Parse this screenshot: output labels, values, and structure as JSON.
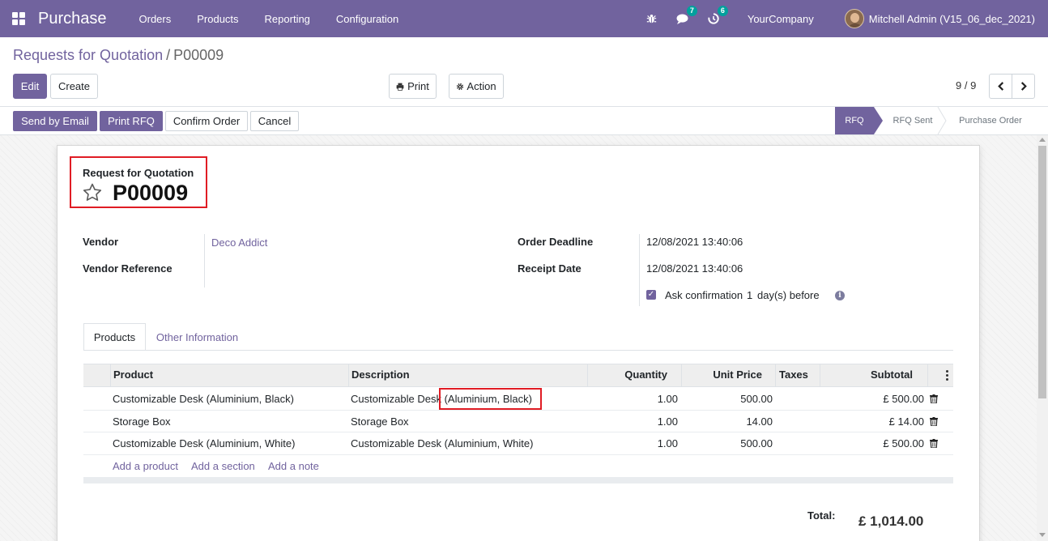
{
  "navbar": {
    "app_name": "Purchase",
    "menu": [
      "Orders",
      "Products",
      "Reporting",
      "Configuration"
    ],
    "chat_count": "7",
    "activity_count": "6",
    "company": "YourCompany",
    "user": "Mitchell Admin (V15_06_dec_2021)"
  },
  "breadcrumb": {
    "parent": "Requests for Quotation",
    "separator": "/",
    "current": "P00009"
  },
  "control": {
    "edit_label": "Edit",
    "create_label": "Create",
    "print_label": "Print",
    "action_label": "Action",
    "pager_value": "9 / 9"
  },
  "status_bar": {
    "buttons": [
      "Send by Email",
      "Print RFQ",
      "Confirm Order",
      "Cancel"
    ],
    "stages": [
      "RFQ",
      "RFQ Sent",
      "Purchase Order"
    ]
  },
  "form": {
    "title_label": "Request for Quotation",
    "name": "P00009",
    "vendor_label": "Vendor",
    "vendor_value": "Deco Addict",
    "vendor_ref_label": "Vendor Reference",
    "vendor_ref_value": "",
    "order_deadline_label": "Order Deadline",
    "order_deadline_value": "12/08/2021 13:40:06",
    "receipt_date_label": "Receipt Date",
    "receipt_date_value": "12/08/2021 13:40:06",
    "ask_confirmation_label": "Ask confirmation",
    "ask_confirmation_days": "1",
    "ask_confirmation_suffix": "day(s) before"
  },
  "tabs": [
    "Products",
    "Other Information"
  ],
  "table": {
    "headers": [
      "Product",
      "Description",
      "Quantity",
      "Unit Price",
      "Taxes",
      "Subtotal"
    ],
    "rows": [
      {
        "product": "Customizable Desk (Aluminium, Black)",
        "description": "Customizable Desk (Aluminium, Black)",
        "quantity": "1.00",
        "unit_price": "500.00",
        "taxes": "",
        "subtotal": "£ 500.00"
      },
      {
        "product": "Storage Box",
        "description": "Storage Box",
        "quantity": "1.00",
        "unit_price": "14.00",
        "taxes": "",
        "subtotal": "£ 14.00"
      },
      {
        "product": "Customizable Desk (Aluminium, White)",
        "description": "Customizable Desk (Aluminium, White)",
        "quantity": "1.00",
        "unit_price": "500.00",
        "taxes": "",
        "subtotal": "£ 500.00"
      }
    ],
    "add_links": [
      "Add a product",
      "Add a section",
      "Add a note"
    ]
  },
  "totals": {
    "total_label": "Total:",
    "total_value": "£ 1,014.00"
  },
  "colors": {
    "brand": "#71639e",
    "highlight": "#e01c24"
  }
}
